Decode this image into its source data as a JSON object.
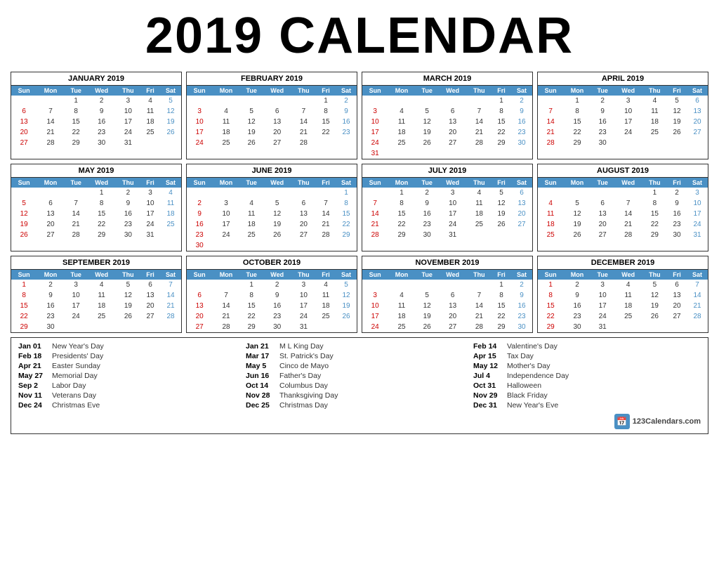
{
  "title": "2019 CALENDAR",
  "months": [
    {
      "name": "JANUARY 2019",
      "weeks": [
        [
          "",
          "",
          "1",
          "2",
          "3",
          "4",
          "5"
        ],
        [
          "6",
          "7",
          "8",
          "9",
          "10",
          "11",
          "12"
        ],
        [
          "13",
          "14",
          "15",
          "16",
          "17",
          "18",
          "19"
        ],
        [
          "20",
          "21",
          "22",
          "23",
          "24",
          "25",
          "26"
        ],
        [
          "27",
          "28",
          "29",
          "30",
          "31",
          "",
          ""
        ]
      ]
    },
    {
      "name": "FEBRUARY 2019",
      "weeks": [
        [
          "",
          "",
          "",
          "",
          "",
          "1",
          "2"
        ],
        [
          "3",
          "4",
          "5",
          "6",
          "7",
          "8",
          "9"
        ],
        [
          "10",
          "11",
          "12",
          "13",
          "14",
          "15",
          "16"
        ],
        [
          "17",
          "18",
          "19",
          "20",
          "21",
          "22",
          "23"
        ],
        [
          "24",
          "25",
          "26",
          "27",
          "28",
          "",
          ""
        ]
      ]
    },
    {
      "name": "MARCH 2019",
      "weeks": [
        [
          "",
          "",
          "",
          "",
          "",
          "1",
          "2"
        ],
        [
          "3",
          "4",
          "5",
          "6",
          "7",
          "8",
          "9"
        ],
        [
          "10",
          "11",
          "12",
          "13",
          "14",
          "15",
          "16"
        ],
        [
          "17",
          "18",
          "19",
          "20",
          "21",
          "22",
          "23"
        ],
        [
          "24",
          "25",
          "26",
          "27",
          "28",
          "29",
          "30"
        ],
        [
          "31",
          "",
          "",
          "",
          "",
          "",
          ""
        ]
      ]
    },
    {
      "name": "APRIL 2019",
      "weeks": [
        [
          "",
          "1",
          "2",
          "3",
          "4",
          "5",
          "6"
        ],
        [
          "7",
          "8",
          "9",
          "10",
          "11",
          "12",
          "13"
        ],
        [
          "14",
          "15",
          "16",
          "17",
          "18",
          "19",
          "20"
        ],
        [
          "21",
          "22",
          "23",
          "24",
          "25",
          "26",
          "27"
        ],
        [
          "28",
          "29",
          "30",
          "",
          "",
          "",
          ""
        ]
      ]
    },
    {
      "name": "MAY 2019",
      "weeks": [
        [
          "",
          "",
          "",
          "1",
          "2",
          "3",
          "4"
        ],
        [
          "5",
          "6",
          "7",
          "8",
          "9",
          "10",
          "11"
        ],
        [
          "12",
          "13",
          "14",
          "15",
          "16",
          "17",
          "18"
        ],
        [
          "19",
          "20",
          "21",
          "22",
          "23",
          "24",
          "25"
        ],
        [
          "26",
          "27",
          "28",
          "29",
          "30",
          "31",
          ""
        ]
      ]
    },
    {
      "name": "JUNE 2019",
      "weeks": [
        [
          "",
          "",
          "",
          "",
          "",
          "",
          "1"
        ],
        [
          "2",
          "3",
          "4",
          "5",
          "6",
          "7",
          "8"
        ],
        [
          "9",
          "10",
          "11",
          "12",
          "13",
          "14",
          "15"
        ],
        [
          "16",
          "17",
          "18",
          "19",
          "20",
          "21",
          "22"
        ],
        [
          "23",
          "24",
          "25",
          "26",
          "27",
          "28",
          "29"
        ],
        [
          "30",
          "",
          "",
          "",
          "",
          "",
          ""
        ]
      ]
    },
    {
      "name": "JULY 2019",
      "weeks": [
        [
          "",
          "1",
          "2",
          "3",
          "4",
          "5",
          "6"
        ],
        [
          "7",
          "8",
          "9",
          "10",
          "11",
          "12",
          "13"
        ],
        [
          "14",
          "15",
          "16",
          "17",
          "18",
          "19",
          "20"
        ],
        [
          "21",
          "22",
          "23",
          "24",
          "25",
          "26",
          "27"
        ],
        [
          "28",
          "29",
          "30",
          "31",
          "",
          "",
          ""
        ]
      ]
    },
    {
      "name": "AUGUST 2019",
      "weeks": [
        [
          "",
          "",
          "",
          "",
          "1",
          "2",
          "3"
        ],
        [
          "4",
          "5",
          "6",
          "7",
          "8",
          "9",
          "10"
        ],
        [
          "11",
          "12",
          "13",
          "14",
          "15",
          "16",
          "17"
        ],
        [
          "18",
          "19",
          "20",
          "21",
          "22",
          "23",
          "24"
        ],
        [
          "25",
          "26",
          "27",
          "28",
          "29",
          "30",
          "31"
        ]
      ]
    },
    {
      "name": "SEPTEMBER 2019",
      "weeks": [
        [
          "1",
          "2",
          "3",
          "4",
          "5",
          "6",
          "7"
        ],
        [
          "8",
          "9",
          "10",
          "11",
          "12",
          "13",
          "14"
        ],
        [
          "15",
          "16",
          "17",
          "18",
          "19",
          "20",
          "21"
        ],
        [
          "22",
          "23",
          "24",
          "25",
          "26",
          "27",
          "28"
        ],
        [
          "29",
          "30",
          "",
          "",
          "",
          "",
          ""
        ]
      ]
    },
    {
      "name": "OCTOBER 2019",
      "weeks": [
        [
          "",
          "",
          "1",
          "2",
          "3",
          "4",
          "5"
        ],
        [
          "6",
          "7",
          "8",
          "9",
          "10",
          "11",
          "12"
        ],
        [
          "13",
          "14",
          "15",
          "16",
          "17",
          "18",
          "19"
        ],
        [
          "20",
          "21",
          "22",
          "23",
          "24",
          "25",
          "26"
        ],
        [
          "27",
          "28",
          "29",
          "30",
          "31",
          "",
          ""
        ]
      ]
    },
    {
      "name": "NOVEMBER 2019",
      "weeks": [
        [
          "",
          "",
          "",
          "",
          "",
          "1",
          "2"
        ],
        [
          "3",
          "4",
          "5",
          "6",
          "7",
          "8",
          "9"
        ],
        [
          "10",
          "11",
          "12",
          "13",
          "14",
          "15",
          "16"
        ],
        [
          "17",
          "18",
          "19",
          "20",
          "21",
          "22",
          "23"
        ],
        [
          "24",
          "25",
          "26",
          "27",
          "28",
          "29",
          "30"
        ]
      ]
    },
    {
      "name": "DECEMBER 2019",
      "weeks": [
        [
          "1",
          "2",
          "3",
          "4",
          "5",
          "6",
          "7"
        ],
        [
          "8",
          "9",
          "10",
          "11",
          "12",
          "13",
          "14"
        ],
        [
          "15",
          "16",
          "17",
          "18",
          "19",
          "20",
          "21"
        ],
        [
          "22",
          "23",
          "24",
          "25",
          "26",
          "27",
          "28"
        ],
        [
          "29",
          "30",
          "31",
          "",
          "",
          "",
          ""
        ]
      ]
    }
  ],
  "days": [
    "Sun",
    "Mon",
    "Tue",
    "Wed",
    "Thu",
    "Fri",
    "Sat"
  ],
  "holidays": {
    "col1": [
      {
        "date": "Jan 01",
        "name": "New Year's Day"
      },
      {
        "date": "Feb 18",
        "name": "Presidents' Day"
      },
      {
        "date": "Apr 21",
        "name": "Easter Sunday"
      },
      {
        "date": "May 27",
        "name": "Memorial Day"
      },
      {
        "date": "Sep 2",
        "name": "Labor Day"
      },
      {
        "date": "Nov 11",
        "name": "Veterans Day"
      },
      {
        "date": "Dec 24",
        "name": "Christmas Eve"
      }
    ],
    "col2": [
      {
        "date": "Jan 21",
        "name": "M L King Day"
      },
      {
        "date": "Mar 17",
        "name": "St. Patrick's Day"
      },
      {
        "date": "May 5",
        "name": "Cinco de Mayo"
      },
      {
        "date": "Jun 16",
        "name": "Father's Day"
      },
      {
        "date": "Oct 14",
        "name": "Columbus Day"
      },
      {
        "date": "Nov 28",
        "name": "Thanksgiving Day"
      },
      {
        "date": "Dec 25",
        "name": "Christmas Day"
      }
    ],
    "col3": [
      {
        "date": "Feb 14",
        "name": "Valentine's Day"
      },
      {
        "date": "Apr 15",
        "name": "Tax Day"
      },
      {
        "date": "May 12",
        "name": "Mother's Day"
      },
      {
        "date": "Jul 4",
        "name": "Independence Day"
      },
      {
        "date": "Oct 31",
        "name": "Halloween"
      },
      {
        "date": "Nov 29",
        "name": "Black Friday"
      },
      {
        "date": "Dec 31",
        "name": "New Year's Eve"
      }
    ]
  },
  "branding": "123Calendars.com"
}
